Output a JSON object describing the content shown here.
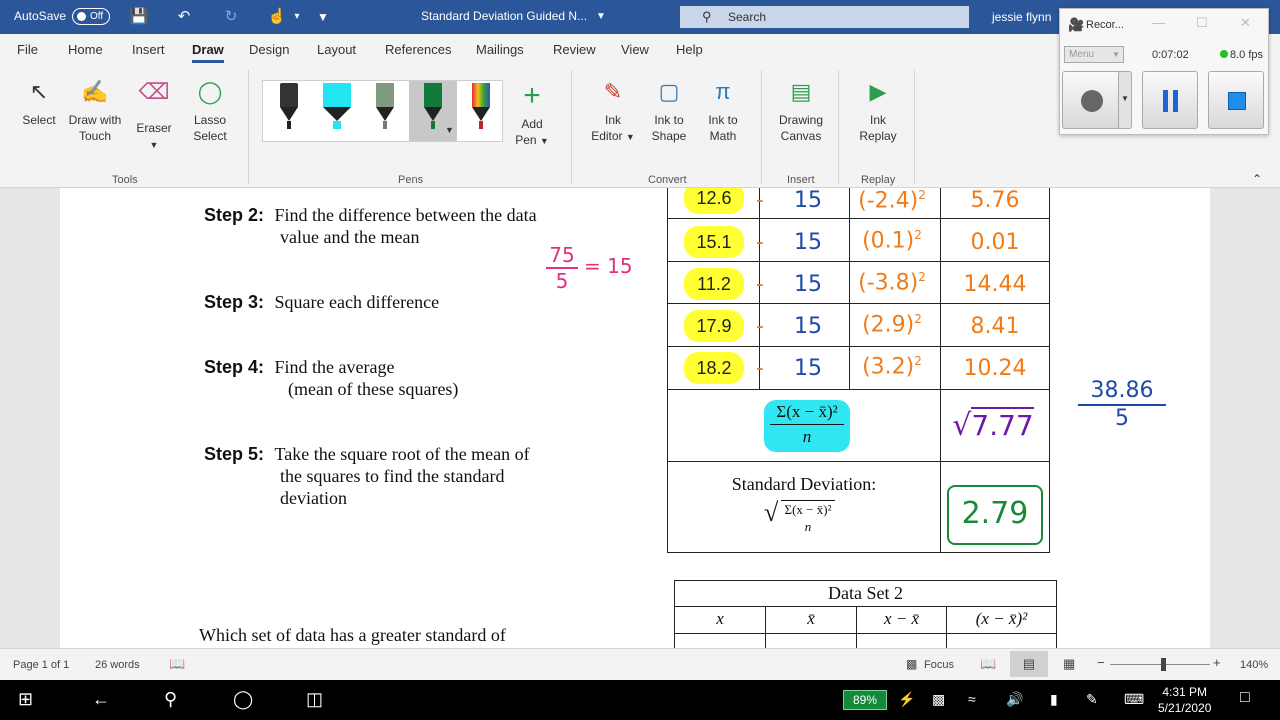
{
  "titlebar": {
    "autosave_label": "AutoSave",
    "autosave_state": "Off",
    "doc_title": "Standard Deviation Guided N...",
    "search_placeholder": "Search",
    "user": "jessie flynn"
  },
  "tabs": [
    "File",
    "Home",
    "Insert",
    "Draw",
    "Design",
    "Layout",
    "References",
    "Mailings",
    "Review",
    "View",
    "Help"
  ],
  "active_tab": "Draw",
  "ribbon": {
    "tools": {
      "select": "Select",
      "draw_touch_1": "Draw with",
      "draw_touch_2": "Touch",
      "eraser": "Eraser",
      "lasso_1": "Lasso",
      "lasso_2": "Select",
      "group": "Tools"
    },
    "pens": {
      "add_pen_1": "Add",
      "add_pen_2": "Pen",
      "group": "Pens"
    },
    "convert": {
      "ink_editor_1": "Ink",
      "ink_editor_2": "Editor",
      "ink_shape_1": "Ink to",
      "ink_shape_2": "Shape",
      "ink_math_1": "Ink to",
      "ink_math_2": "Math",
      "group": "Convert"
    },
    "insert": {
      "drawing_1": "Drawing",
      "drawing_2": "Canvas",
      "group": "Insert"
    },
    "replay": {
      "ink_replay_1": "Ink",
      "ink_replay_2": "Replay",
      "group": "Replay"
    }
  },
  "recorder": {
    "title": "Recor...",
    "menu": "Menu",
    "time": "0:07:02",
    "fps": "8.0 fps"
  },
  "document": {
    "step2_label": "Step 2:",
    "step2_text_1": "Find the difference between the data",
    "step2_text_2": "value and the mean",
    "step3_label": "Step 3:",
    "step3_text": "Square each difference",
    "step4_label": "Step 4:",
    "step4_text_1": "Find the average",
    "step4_text_2": "(mean of these squares)",
    "step5_label": "Step 5:",
    "step5_text_1": "Take the square root of the mean of",
    "step5_text_2": "the squares to find the standard",
    "step5_text_3": "deviation",
    "question": "Which set of data has a greater standard of",
    "mean_note_num": "75",
    "mean_note_den": "5",
    "mean_note_result": "= 15",
    "rows": [
      {
        "x": "12.6",
        "mean": "15",
        "diff": "(-2.4)",
        "sq": "5.76"
      },
      {
        "x": "15.1",
        "mean": "15",
        "diff": "(0.1)",
        "sq": "0.01"
      },
      {
        "x": "11.2",
        "mean": "15",
        "diff": "(-3.8)",
        "sq": "14.44"
      },
      {
        "x": "17.9",
        "mean": "15",
        "diff": "(2.9)",
        "sq": "8.41"
      },
      {
        "x": "18.2",
        "mean": "15",
        "diff": "(3.2)",
        "sq": "10.24"
      }
    ],
    "exponent": "2",
    "variance_num": "Σ(x − x̄)²",
    "variance_den": "n",
    "variance_value": "7.77",
    "sd_label": "Standard Deviation:",
    "sd_value": "2.79",
    "side_num": "38.86",
    "side_den": "5",
    "dataset2_title": "Data Set 2",
    "dataset2_headers": [
      "x",
      "x̄",
      "x − x̄",
      "(x − x̄)²"
    ]
  },
  "statusbar": {
    "page": "Page 1 of 1",
    "words": "26 words",
    "focus": "Focus",
    "zoom": "140%"
  },
  "taskbar": {
    "battery": "89%",
    "time": "4:31 PM",
    "date": "5/21/2020"
  }
}
